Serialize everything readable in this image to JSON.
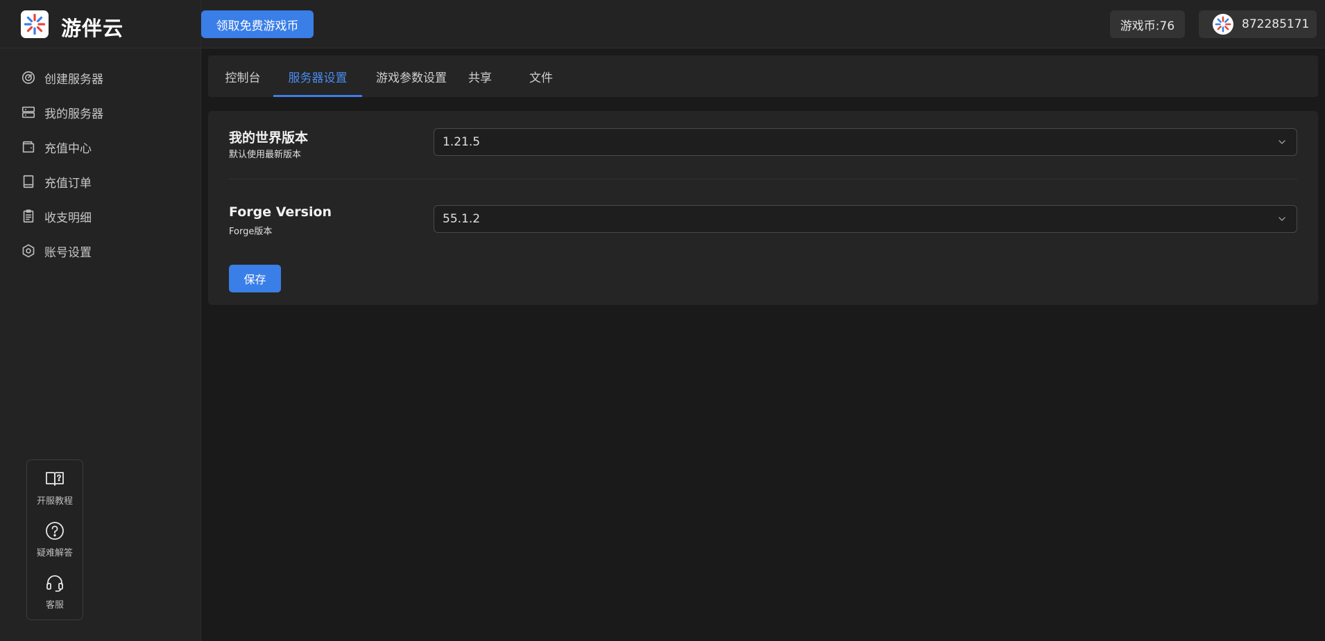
{
  "app": {
    "name": "游伴云"
  },
  "header": {
    "promo_button": "领取免费游戏币",
    "coins": "游戏币:76",
    "user_id": "872285171"
  },
  "sidebar": {
    "items": [
      {
        "label": "创建服务器",
        "icon": "gauge-icon"
      },
      {
        "label": "我的服务器",
        "icon": "server-icon"
      },
      {
        "label": "充值中心",
        "icon": "wallet-icon"
      },
      {
        "label": "充值订单",
        "icon": "book-icon"
      },
      {
        "label": "收支明细",
        "icon": "clipboard-icon"
      },
      {
        "label": "账号设置",
        "icon": "hexagon-settings-icon"
      }
    ],
    "help": [
      {
        "label": "开服教程",
        "icon": "book-question-icon"
      },
      {
        "label": "疑难解答",
        "icon": "question-circle-icon"
      },
      {
        "label": "客服",
        "icon": "headset-icon"
      }
    ]
  },
  "tabs": [
    {
      "label": "控制台",
      "active": false
    },
    {
      "label": "服务器设置",
      "active": true
    },
    {
      "label": "游戏参数设置",
      "active": false
    },
    {
      "label": "共享",
      "active": false
    },
    {
      "label": "文件",
      "active": false
    }
  ],
  "settings": {
    "minecraft_version": {
      "title": "我的世界版本",
      "subtitle": "默认使用最新版本",
      "value": "1.21.5"
    },
    "forge_version": {
      "title": "Forge Version",
      "subtitle": "Forge版本",
      "value": "55.1.2"
    },
    "save_label": "保存"
  },
  "colors": {
    "accent": "#3a7ee8",
    "background": "#1a1a1a",
    "panel": "#252525",
    "active_tab": "#4a8cf0"
  }
}
